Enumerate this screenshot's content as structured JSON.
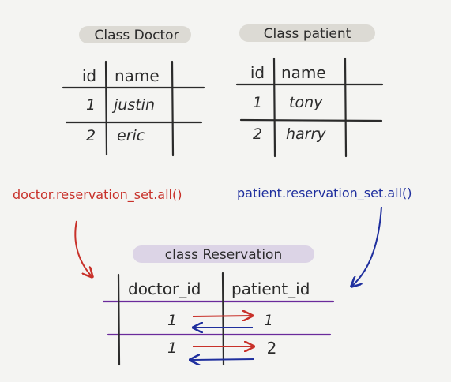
{
  "doctor": {
    "title": "Class Doctor",
    "headers": [
      "id",
      "name"
    ],
    "rows": [
      [
        "1",
        "justin"
      ],
      [
        "2",
        "eric"
      ]
    ]
  },
  "patient": {
    "title": "Class patient",
    "headers": [
      "id",
      "name"
    ],
    "rows": [
      [
        "1",
        "tony"
      ],
      [
        "2",
        "harry"
      ]
    ]
  },
  "reservation": {
    "title": "class Reservation",
    "headers": [
      "doctor_id",
      "patient_id"
    ],
    "rows": [
      [
        "1",
        "1"
      ],
      [
        "1",
        "2"
      ]
    ]
  },
  "annotations": {
    "doctor_query": "doctor.reservation_set.all()",
    "patient_query": "patient.reservation_set.all()"
  },
  "colors": {
    "ink": "#2b2b2b",
    "red": "#c8312a",
    "blue": "#1f2f9e",
    "purple": "#6a2a9b",
    "label_bg": "#dcdad4",
    "reservation_label_bg": "#dcd4e6",
    "background": "#f4f4f2"
  }
}
